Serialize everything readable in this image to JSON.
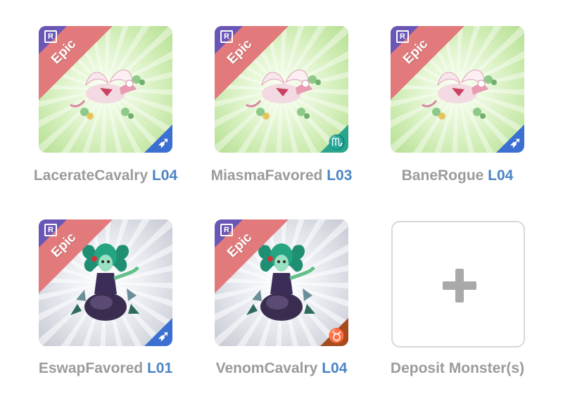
{
  "monsters": [
    {
      "name": "LacerateCavalry",
      "level": "L04",
      "rarity": "Epic",
      "rarity_badge": "R",
      "class_icon": "archer-arrow-icon",
      "theme": "green"
    },
    {
      "name": "MiasmaFavored",
      "level": "L03",
      "rarity": "Epic",
      "rarity_badge": "R",
      "class_icon": "scorpio-icon",
      "theme": "green"
    },
    {
      "name": "BaneRogue",
      "level": "L04",
      "rarity": "Epic",
      "rarity_badge": "R",
      "class_icon": "archer-arrow-icon",
      "theme": "green"
    },
    {
      "name": "EswapFavored",
      "level": "L01",
      "rarity": "Epic",
      "rarity_badge": "R",
      "class_icon": "archer-arrow-icon",
      "theme": "silver"
    },
    {
      "name": "VenomCavalry",
      "level": "L04",
      "rarity": "Epic",
      "rarity_badge": "R",
      "class_icon": "taurus-icon",
      "theme": "silver"
    }
  ],
  "deposit": {
    "label": "Deposit Monster(s)"
  },
  "colors": {
    "epic_ribbon": "#e27a7b",
    "rarity_corner": "#6a56b5",
    "level_text": "#4a84c4",
    "name_text": "#9b9b9b",
    "class_blue": "#3b6fd1",
    "class_teal": "#2aa58c",
    "class_brown": "#a44c1d"
  }
}
